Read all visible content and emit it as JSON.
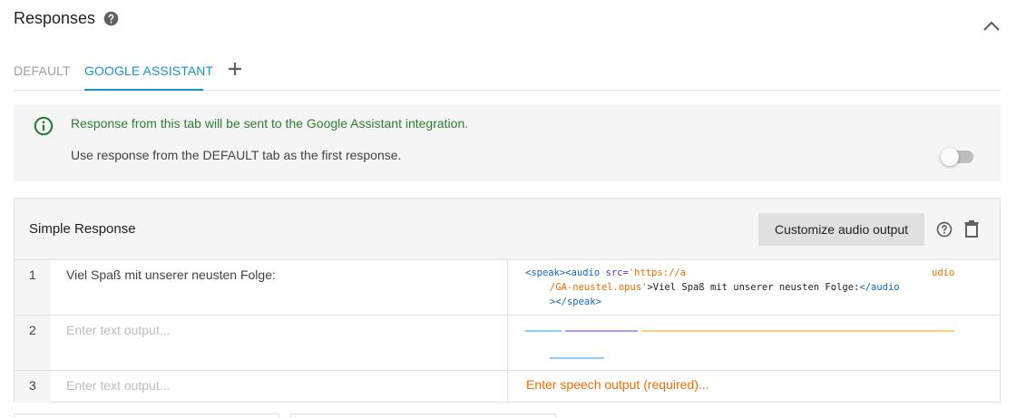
{
  "header": {
    "title": "Responses",
    "help_icon": "help-circle-icon",
    "collapse_icon": "chevron-up-icon"
  },
  "tabs": [
    {
      "label": "DEFAULT",
      "active": false
    },
    {
      "label": "GOOGLE ASSISTANT",
      "active": true
    }
  ],
  "add_tab_icon": "plus-icon",
  "info": {
    "icon": "info-icon",
    "message": "Response from this tab will be sent to the Google Assistant integration.",
    "use_default_label": "Use response from the DEFAULT tab as the first response.",
    "use_default_toggle_on": false
  },
  "simple_response": {
    "title": "Simple Response",
    "customize_button": "Customize audio output",
    "help_icon": "help-circle-icon",
    "delete_icon": "trash-icon",
    "rows": [
      {
        "number": "1",
        "text_value": "Viel Spaß mit unserer neusten Folge:",
        "text_placeholder": "Enter text output...",
        "ssml_tag_open": "<speak><audio",
        "ssml_attr": "src=",
        "ssml_src_start": "'https://a",
        "ssml_src_end": "udio",
        "ssml_src_line2": "/GA-neustel.opus'",
        "ssml_text": ">Viel Spaß mit unserer neusten Folge:",
        "ssml_close_audio": "</audio",
        "ssml_close_line3": "></speak>"
      },
      {
        "number": "2",
        "text_value": "",
        "text_placeholder": "Enter text output..."
      },
      {
        "number": "3",
        "text_value": "",
        "text_placeholder": "Enter text output...",
        "speech_placeholder": "Enter speech output (required)..."
      }
    ]
  },
  "colors": {
    "accent": "#1a8fd1",
    "success_text": "#2e7d32",
    "warning_text": "#ef6c00",
    "panel_bg": "#f5f5f5",
    "border": "#e0e0e0"
  }
}
